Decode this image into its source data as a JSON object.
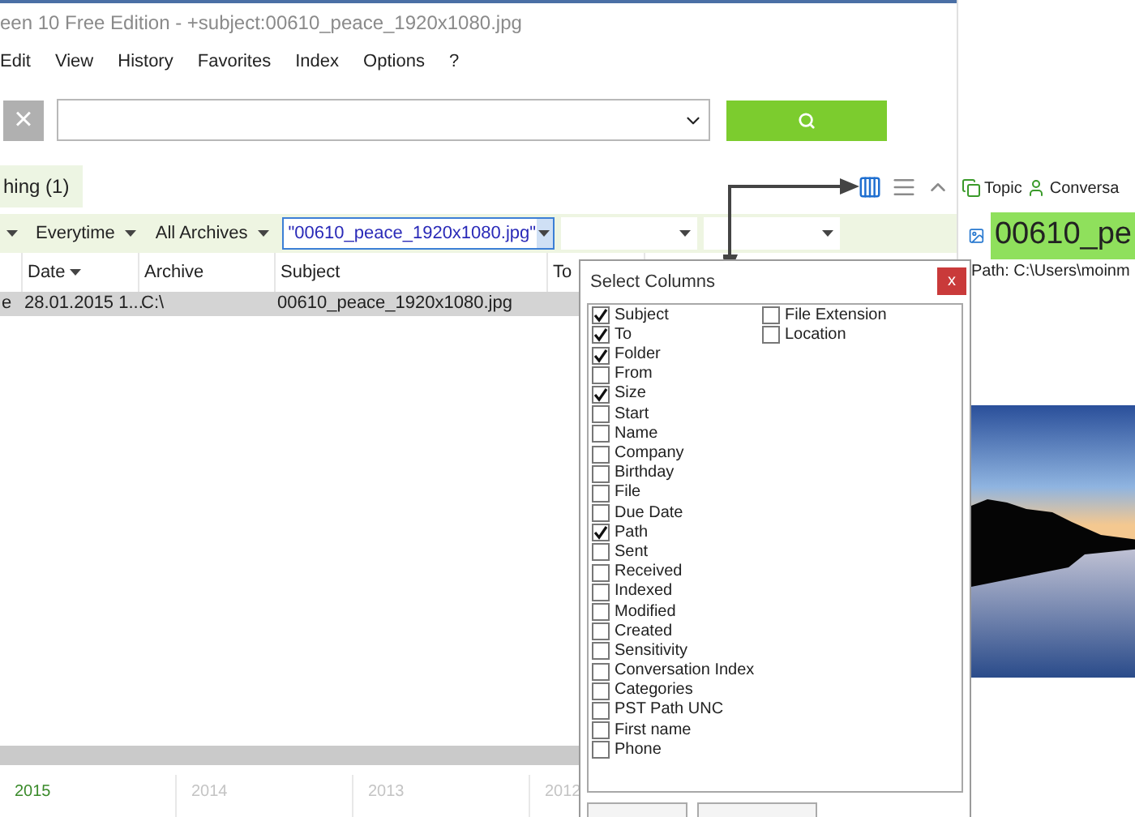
{
  "window": {
    "title": "een 10 Free Edition - +subject:00610_peace_1920x1080.jpg"
  },
  "menu": [
    "Edit",
    "View",
    "History",
    "Favorites",
    "Index",
    "Options",
    "?"
  ],
  "search": {
    "clear_label": "×"
  },
  "result_tab": {
    "label": "hing (1)",
    "selected": true
  },
  "view_buttons": [
    {
      "kind": "columns",
      "selected": true
    },
    {
      "kind": "list",
      "selected": false
    },
    {
      "kind": "collapse",
      "selected": false
    }
  ],
  "preview_tabs": [
    {
      "kind": "topic",
      "label": "Topic"
    },
    {
      "kind": "person",
      "label": "Conversa"
    }
  ],
  "filters": [
    {
      "kind": "dropdown"
    },
    {
      "kind": "dropdown",
      "label": "Everytime"
    },
    {
      "kind": "dropdown",
      "label": "All Archives"
    },
    {
      "kind": "field",
      "value": "\"00610_peace_1920x1080.jpg\""
    },
    {
      "kind": "dropdown"
    },
    {
      "kind": "dropdown"
    }
  ],
  "table": {
    "columns": [
      {
        "sorted": false
      },
      {
        "label": "Date",
        "sorted": true
      },
      {
        "label": "Archive",
        "sorted": false
      },
      {
        "label": "Subject",
        "sorted": false
      },
      {
        "label": "To",
        "sorted": false
      }
    ],
    "rows": [
      {
        "cells": [
          "e",
          "28.01.2015 1...",
          "C:\\",
          "00610_peace_1920x1080.jpg",
          ""
        ],
        "selected": true
      }
    ]
  },
  "timeline": [
    {
      "label": "2015",
      "selected": true
    },
    {
      "label": "2014",
      "selected": false
    },
    {
      "label": "2013",
      "selected": false
    },
    {
      "label": "2012",
      "selected": false
    }
  ],
  "preview": {
    "title": "00610_pe",
    "path": "Path: C:\\Users\\moinm"
  },
  "dialog": {
    "title": "Select Columns",
    "close_label": "x",
    "columns": [
      [
        {
          "label": "Subject",
          "checked": true
        },
        {
          "label": "To",
          "checked": true
        },
        {
          "label": "Folder",
          "checked": true
        },
        {
          "label": "From",
          "checked": false
        },
        {
          "label": "Size",
          "checked": true
        },
        {
          "label": "Start",
          "checked": false
        },
        {
          "label": "Name",
          "checked": false
        },
        {
          "label": "Company",
          "checked": false
        },
        {
          "label": "Birthday",
          "checked": false
        },
        {
          "label": "File",
          "checked": false
        },
        {
          "label": "Due Date",
          "checked": false
        },
        {
          "label": "Path",
          "checked": true
        },
        {
          "label": "Sent",
          "checked": false
        },
        {
          "label": "Received",
          "checked": false
        },
        {
          "label": "Indexed",
          "checked": false
        },
        {
          "label": "Modified",
          "checked": false
        },
        {
          "label": "Created",
          "checked": false
        },
        {
          "label": "Sensitivity",
          "checked": false
        },
        {
          "label": "Conversation Index",
          "checked": false
        },
        {
          "label": "Categories",
          "checked": false
        },
        {
          "label": "PST Path UNC",
          "checked": false
        },
        {
          "label": "First name",
          "checked": false
        },
        {
          "label": "Phone",
          "checked": false
        }
      ],
      [
        {
          "label": "File Extension",
          "checked": false
        },
        {
          "label": "Location",
          "checked": false
        }
      ]
    ]
  }
}
